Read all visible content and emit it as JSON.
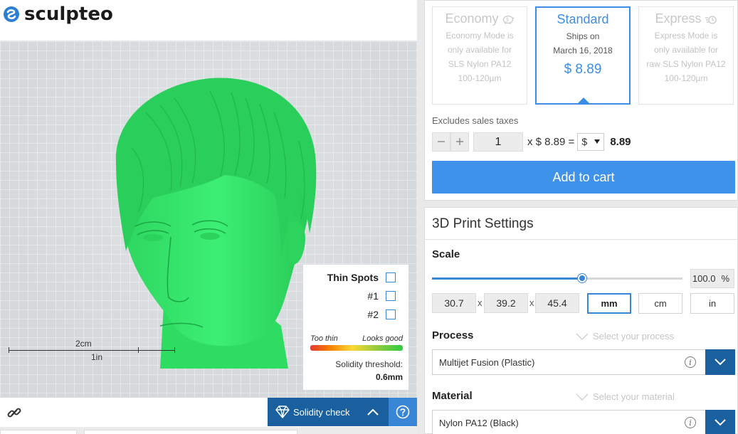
{
  "brand": {
    "name": "sculpteo"
  },
  "viewer": {
    "scale_bar": {
      "metric": "2cm",
      "imperial": "1in"
    },
    "thin_spots": {
      "title": "Thin Spots",
      "items": [
        "#1",
        "#2"
      ],
      "too_thin": "Too thin",
      "looks_good": "Looks good",
      "threshold_label": "Solidity threshold:",
      "threshold_value": "0.6mm"
    },
    "model_color": "#35e86a"
  },
  "bottom_bar": {
    "link_icon": "link-icon",
    "solidity_label": "Solidity check",
    "help_icon": "help-icon"
  },
  "pricing": {
    "modes": [
      {
        "name": "Economy",
        "icon": "piggy-bank-icon",
        "lines": [
          "Economy Mode is",
          "only available for",
          "SLS Nylon PA12",
          "100-120µm"
        ]
      },
      {
        "name": "Standard",
        "lines": [
          "Ships on",
          "March 16, 2018"
        ],
        "price": "$ 8.89"
      },
      {
        "name": "Express",
        "icon": "fast-icon",
        "lines": [
          "Express Mode is",
          "only available for",
          "raw SLS Nylon PA12",
          "100-120µm"
        ]
      }
    ],
    "excludes_taxes": "Excludes sales taxes",
    "quantity": "1",
    "unit_price": "x $ 8.89 =",
    "currency": "$",
    "total": "8.89",
    "add_to_cart": "Add to cart"
  },
  "settings": {
    "title": "3D Print Settings",
    "scale": {
      "label": "Scale",
      "value": "100.0",
      "unit_symbol": "%",
      "slider_fraction": 0.6,
      "dimensions": [
        "30.7",
        "39.2",
        "45.4"
      ],
      "separator": "x",
      "units": [
        "mm",
        "cm",
        "in"
      ],
      "selected_unit": "mm"
    },
    "process": {
      "label": "Process",
      "hint": "Select your process",
      "value": "Multijet Fusion (Plastic)"
    },
    "material": {
      "label": "Material",
      "hint": "Select your material",
      "value": "Nylon PA12 (Black)"
    }
  },
  "colors": {
    "accent": "#3a8ee6",
    "dark_blue": "#1a5f9e",
    "model_green": "#35e86a"
  }
}
